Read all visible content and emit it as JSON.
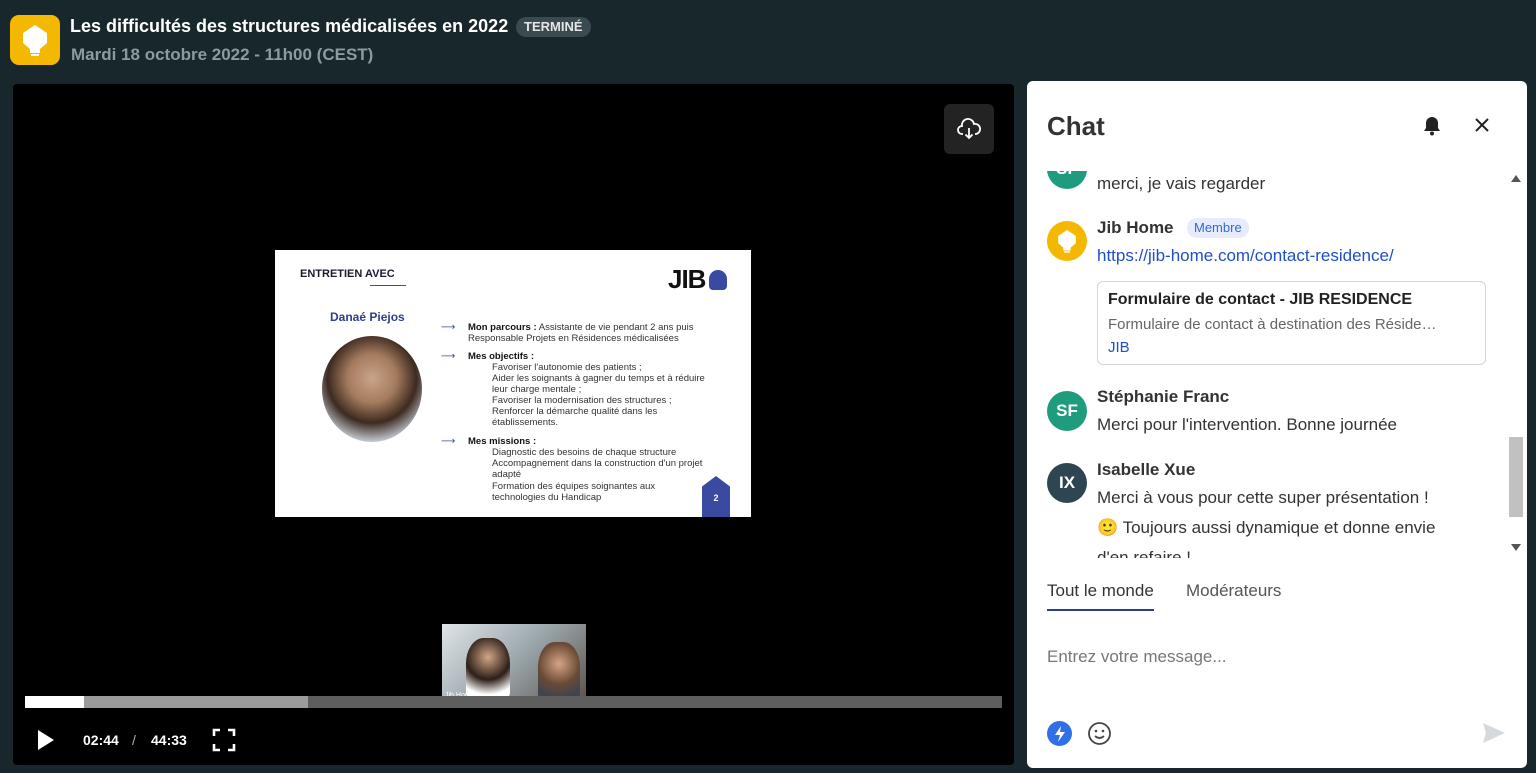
{
  "header": {
    "title": "Les difficultés des structures médicalisées en 2022",
    "status_badge": "TERMINÉ",
    "datetime": "Mardi 18 octobre 2022 - 11h00 (CEST)"
  },
  "player": {
    "current_time": "02:44",
    "separator": "/",
    "duration": "44:33",
    "progress_played_fraction": 0.06,
    "progress_buffered_fraction": 0.29,
    "slide": {
      "heading": "ENTRETIEN AVEC",
      "logo": "JIB",
      "person": "Danaé Piejos",
      "parcours_label": "Mon parcours :",
      "parcours_line1": "Assistante de vie pendant 2 ans puis",
      "parcours_line2": "Responsable Projets en Résidences médicalisées",
      "objectifs_label": "Mes objectifs :",
      "objectifs": [
        "Favoriser l'autonomie des patients ;",
        "Aider les soignants à gagner du temps et à réduire",
        "leur charge mentale ;",
        "Favoriser la modernisation des structures ;",
        "Renforcer la démarche qualité dans les",
        "établissements."
      ],
      "missions_label": "Mes missions :",
      "missions": [
        "Diagnostic des besoins de chaque structure",
        "Accompagnement dans la construction d'un projet",
        "adapté",
        "Formation des équipes soignantes aux",
        "technologies du Handicap"
      ],
      "page_number": "2"
    },
    "pip_label": "Jib Home"
  },
  "chat": {
    "title": "Chat",
    "messages": [
      {
        "avatar_initials": "SF",
        "text": "merci, je vais regarder"
      },
      {
        "author": "Jib Home",
        "role_badge": "Membre",
        "link": "https://jib-home.com/contact-residence/",
        "preview_title": "Formulaire de contact - JIB RESIDENCE",
        "preview_description": "Formulaire de contact à destination des Réside…",
        "preview_source": "JIB"
      },
      {
        "author": "Stéphanie Franc",
        "avatar_initials": "SF",
        "text": "Merci pour l'intervention. Bonne journée"
      },
      {
        "author": "Isabelle Xue",
        "avatar_initials": "IX",
        "text_line1": "Merci à vous pour cette super présentation !",
        "emoji": "🙂",
        "text_line2": "Toujours aussi dynamique et donne envie",
        "text_line3": "d'en refaire !"
      }
    ],
    "tabs": [
      "Tout le monde",
      "Modérateurs"
    ],
    "active_tab": "Tout le monde",
    "input_placeholder": "Entrez votre message..."
  },
  "colors": {
    "page_bg": "#17272b",
    "brand_yellow": "#f5b800",
    "avatar_green": "#1f9b7d",
    "avatar_dark": "#2e4552",
    "link_blue": "#1f4fc8",
    "slide_blue": "#3a4aa0"
  }
}
